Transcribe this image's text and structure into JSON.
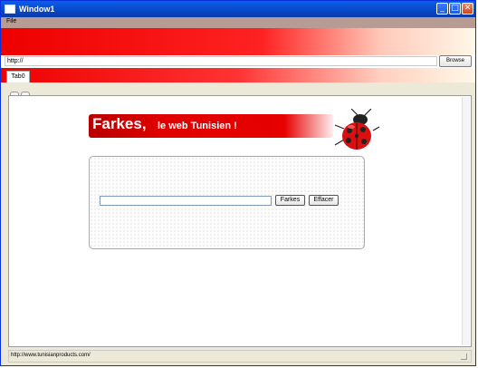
{
  "window": {
    "title": "Window1",
    "buttons": {
      "minimize": "_",
      "maximize": "□",
      "close": "✕"
    }
  },
  "menu": {
    "file": "File"
  },
  "address": {
    "value": "http://",
    "browse_label": "Browse"
  },
  "tabs": [
    {
      "label": "Tab0"
    }
  ],
  "page": {
    "logo_brand": "Farkes,",
    "logo_tagline": "le web Tunisien !",
    "search_value": "",
    "search_button": "Farkes",
    "clear_button": "Effacer"
  },
  "status": {
    "text": "http://www.tunisianproducts.com/"
  },
  "colors": {
    "accent": "#e60000",
    "titlebar": "#0847c9"
  }
}
